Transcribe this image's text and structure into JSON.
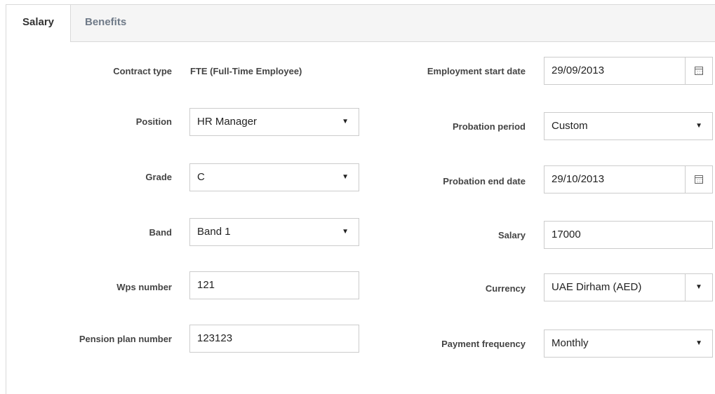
{
  "tabs": [
    {
      "label": "Salary",
      "active": true
    },
    {
      "label": "Benefits",
      "active": false
    }
  ],
  "left": {
    "contract_type": {
      "label": "Contract type",
      "value": "FTE (Full-Time Employee)"
    },
    "position": {
      "label": "Position",
      "value": "HR Manager"
    },
    "grade": {
      "label": "Grade",
      "value": "C"
    },
    "band": {
      "label": "Band",
      "value": "Band 1"
    },
    "wps_number": {
      "label": "Wps number",
      "value": "121"
    },
    "pension_plan_number": {
      "label": "Pension plan number",
      "value": "123123"
    }
  },
  "right": {
    "employment_start_date": {
      "label": "Employment start date",
      "value": "29/09/2013"
    },
    "probation_period": {
      "label": "Probation period",
      "value": "Custom"
    },
    "probation_end_date": {
      "label": "Probation end date",
      "value": "29/10/2013"
    },
    "salary": {
      "label": "Salary",
      "value": "17000"
    },
    "currency": {
      "label": "Currency",
      "value": "UAE Dirham (AED)"
    },
    "payment_frequency": {
      "label": "Payment frequency",
      "value": "Monthly"
    }
  },
  "icons": {
    "dropdown_arrow": "▼",
    "calendar": "calendar-icon"
  }
}
